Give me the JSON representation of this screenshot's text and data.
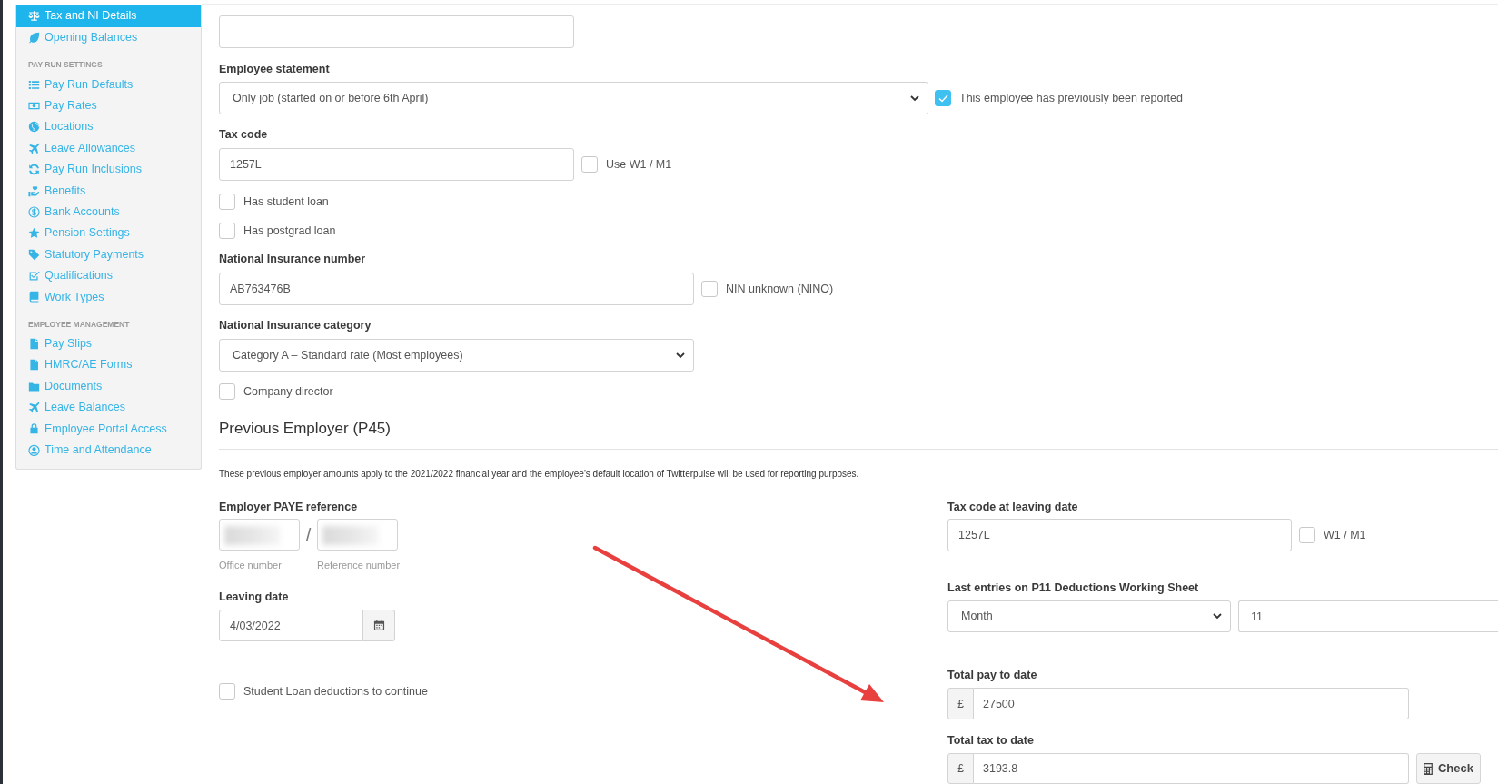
{
  "sidebar": {
    "sections": [
      {
        "items": [
          {
            "label": "Tax and NI Details",
            "selected": true
          },
          {
            "label": "Opening Balances",
            "selected": false
          }
        ]
      },
      {
        "heading": "PAY RUN SETTINGS",
        "items": [
          {
            "label": "Pay Run Defaults",
            "selected": false
          },
          {
            "label": "Pay Rates",
            "selected": false
          },
          {
            "label": "Locations",
            "selected": false
          },
          {
            "label": "Leave Allowances",
            "selected": false
          },
          {
            "label": "Pay Run Inclusions",
            "selected": false
          },
          {
            "label": "Benefits",
            "selected": false
          },
          {
            "label": "Bank Accounts",
            "selected": false
          },
          {
            "label": "Pension Settings",
            "selected": false
          },
          {
            "label": "Statutory Payments",
            "selected": false
          },
          {
            "label": "Qualifications",
            "selected": false
          },
          {
            "label": "Work Types",
            "selected": false
          }
        ]
      },
      {
        "heading": "EMPLOYEE MANAGEMENT",
        "items": [
          {
            "label": "Pay Slips",
            "selected": false
          },
          {
            "label": "HMRC/AE Forms",
            "selected": false
          },
          {
            "label": "Documents",
            "selected": false
          },
          {
            "label": "Leave Balances",
            "selected": false
          },
          {
            "label": "Employee Portal Access",
            "selected": false
          },
          {
            "label": "Time and Attendance",
            "selected": false
          }
        ]
      }
    ]
  },
  "employee_details": {
    "employee_statement": {
      "label": "Employee statement",
      "value": "Only job (started on or before 6th April)",
      "checkbox": {
        "label": "This employee has previously been reported",
        "checked": true
      }
    },
    "tax_code": {
      "label": "Tax code",
      "value": "1257L",
      "checkbox": {
        "label": "Use W1 / M1",
        "checked": false
      }
    },
    "loans": [
      {
        "label": "Has student loan",
        "checked": false
      },
      {
        "label": "Has postgrad loan",
        "checked": false
      }
    ],
    "ni_number": {
      "label": "National Insurance number",
      "value": "AB763476B",
      "checkbox": {
        "label": "NIN unknown (NINO)",
        "checked": false
      }
    },
    "ni_category": {
      "label": "National Insurance category",
      "value": "Category A – Standard rate (Most employees)"
    },
    "company_director": {
      "label": "Company director",
      "checked": false
    }
  },
  "previous_employer": {
    "title": "Previous Employer (P45)",
    "note": "These previous employer amounts apply to the 2021/2022 financial year and the employee's default location of Twitterpulse will be used for reporting purposes.",
    "paye_reference": {
      "label": "Employer PAYE reference",
      "separator": "/",
      "parts": [
        {
          "caption": "Office number",
          "redacted": true
        },
        {
          "caption": "Reference number",
          "redacted": true
        }
      ]
    },
    "leaving_date": {
      "label": "Leaving date",
      "value": "4/03/2022"
    },
    "student_loan_continue": {
      "label": "Student Loan deductions to continue",
      "checked": false
    },
    "tax_code_at_leaving": {
      "label": "Tax code at leaving date",
      "value": "1257L",
      "checkbox": {
        "label": "W1 / M1",
        "checked": false
      }
    },
    "last_entries": {
      "label": "Last entries on P11 Deductions Working Sheet",
      "period": "Month",
      "number": "11"
    },
    "total_pay": {
      "label": "Total pay to date",
      "currency": "£",
      "value": "27500"
    },
    "total_tax": {
      "label": "Total tax to date",
      "currency": "£",
      "value": "3193.8",
      "button": "Check"
    }
  }
}
